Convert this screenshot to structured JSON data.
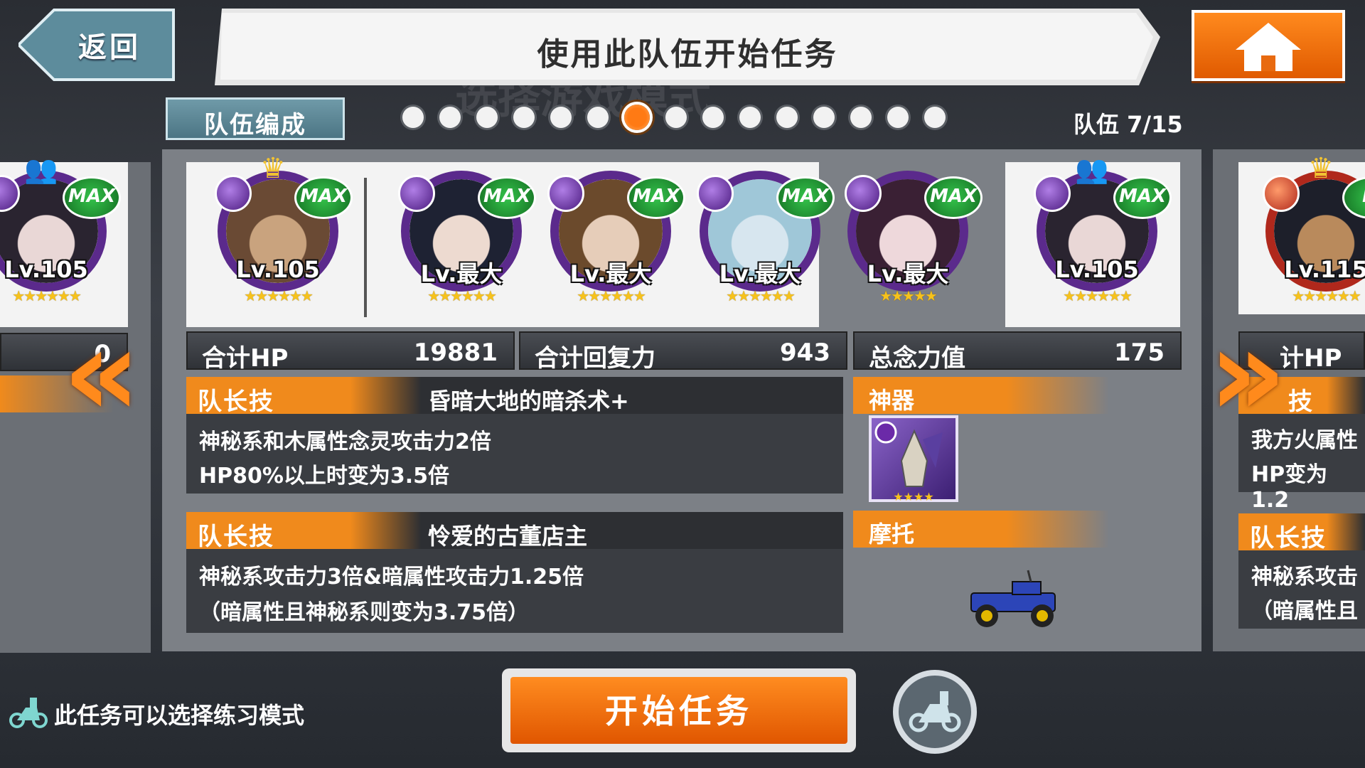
{
  "header": {
    "back_label": "返回",
    "title": "使用此队伍开始任务",
    "home_icon": "house-icon"
  },
  "team": {
    "tab_label": "队伍编成",
    "page_count": 15,
    "current_page": 7,
    "count_label": "队伍 7/15"
  },
  "characters": [
    {
      "id": "c0",
      "level": "Lv.105",
      "badge": "MAX",
      "attr": "dark",
      "stars": 6,
      "marker": "friend",
      "position": "left-preview"
    },
    {
      "id": "c1",
      "level": "Lv.105",
      "badge": "MAX",
      "attr": "dark",
      "stars": 6,
      "marker": "crown",
      "role": "leader"
    },
    {
      "id": "c2",
      "level": "Lv.最大",
      "badge": "MAX",
      "attr": "dark",
      "stars": 6
    },
    {
      "id": "c3",
      "level": "Lv.最大",
      "badge": "MAX",
      "attr": "dark",
      "stars": 6
    },
    {
      "id": "c4",
      "level": "Lv.最大",
      "badge": "MAX",
      "attr": "dark",
      "stars": 6
    },
    {
      "id": "c5",
      "level": "Lv.最大",
      "badge": "MAX",
      "attr": "dark",
      "stars": 5
    },
    {
      "id": "c6",
      "level": "Lv.105",
      "badge": "MAX",
      "attr": "dark",
      "stars": 6,
      "marker": "friend",
      "role": "helper"
    },
    {
      "id": "c7",
      "level": "Lv.115",
      "badge": "M",
      "attr": "fire",
      "stars": 6,
      "marker": "crown",
      "position": "right-preview"
    }
  ],
  "stats": {
    "hp_label": "合计HP",
    "hp_value": "19881",
    "heal_label": "合计回复力",
    "heal_value": "943",
    "power_label": "总念力值",
    "power_value": "175",
    "left_peek_value": "0",
    "right_peek_label": "计HP"
  },
  "skills": [
    {
      "tag": "队长技",
      "name": "昏暗大地的暗杀术+",
      "lines": [
        "神秘系和木属性念灵攻击力2倍",
        "HP80%以上时变为3.5倍"
      ]
    },
    {
      "tag": "队长技",
      "name": "怜爱的古董店主",
      "lines": [
        "神秘系攻击力3倍&暗属性攻击力1.25倍",
        "（暗属性且神秘系则变为3.75倍）"
      ]
    }
  ],
  "equipment": {
    "artifact_label": "神器",
    "artifact_stars": 4,
    "vehicle_label": "摩托"
  },
  "right_peek": {
    "skill_tag": "技",
    "skill_tag2": "队长技",
    "line1": "我方火属性",
    "line2": "HP变为1.2",
    "line3": "神秘系攻击",
    "line4": "（暗属性且"
  },
  "bottom": {
    "practice_text": "此任务可以选择练习模式",
    "start_label": "开始任务",
    "moto_icon": "scooter-icon"
  },
  "colors": {
    "accent": "#f08a1c",
    "dark_attr": "#5b2a8c",
    "max_badge": "#2aa83c"
  }
}
